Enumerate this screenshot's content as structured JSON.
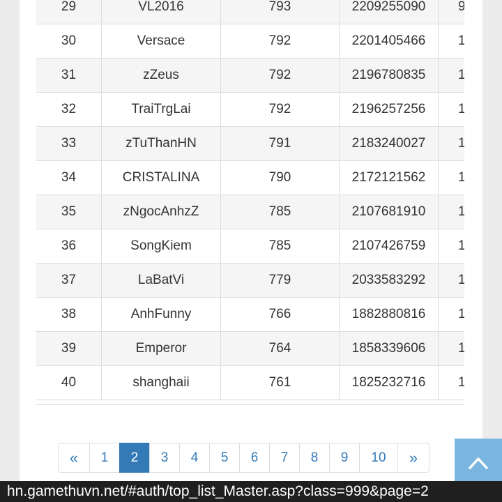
{
  "ranking": {
    "rows": [
      {
        "rank": "29",
        "name": "VL2016",
        "level": "793",
        "exp": "2209255090",
        "extra": "9"
      },
      {
        "rank": "30",
        "name": "Versace",
        "level": "792",
        "exp": "2201405466",
        "extra": "1"
      },
      {
        "rank": "31",
        "name": "zZeus",
        "level": "792",
        "exp": "2196780835",
        "extra": "1"
      },
      {
        "rank": "32",
        "name": "TraiTrgLai",
        "level": "792",
        "exp": "2196257256",
        "extra": "1"
      },
      {
        "rank": "33",
        "name": "zTuThanHN",
        "level": "791",
        "exp": "2183240027",
        "extra": "1"
      },
      {
        "rank": "34",
        "name": "CRISTALINA",
        "level": "790",
        "exp": "2172121562",
        "extra": "1"
      },
      {
        "rank": "35",
        "name": "zNgocAnhzZ",
        "level": "785",
        "exp": "2107681910",
        "extra": "1"
      },
      {
        "rank": "36",
        "name": "SongKiem",
        "level": "785",
        "exp": "2107426759",
        "extra": "1"
      },
      {
        "rank": "37",
        "name": "LaBatVi",
        "level": "779",
        "exp": "2033583292",
        "extra": "1"
      },
      {
        "rank": "38",
        "name": "AnhFunny",
        "level": "766",
        "exp": "1882880816",
        "extra": "1"
      },
      {
        "rank": "39",
        "name": "Emperor",
        "level": "764",
        "exp": "1858339606",
        "extra": "1"
      },
      {
        "rank": "40",
        "name": "shanghaii",
        "level": "761",
        "exp": "1825232716",
        "extra": "1"
      }
    ]
  },
  "pagination": {
    "prev": "«",
    "next": "»",
    "pages": [
      "1",
      "2",
      "3",
      "4",
      "5",
      "6",
      "7",
      "8",
      "9",
      "10"
    ],
    "active": "2"
  },
  "scroll_top": {
    "icon": "chevron-up-icon",
    "color": "#7ab6e0"
  },
  "statusbar": {
    "url": "hn.gamethuvn.net/#auth/top_list_Master.asp?class=999&page=2"
  },
  "colors": {
    "accent": "#337ab7",
    "row_stripe": "#f5f5f5",
    "border": "#dddddd"
  }
}
